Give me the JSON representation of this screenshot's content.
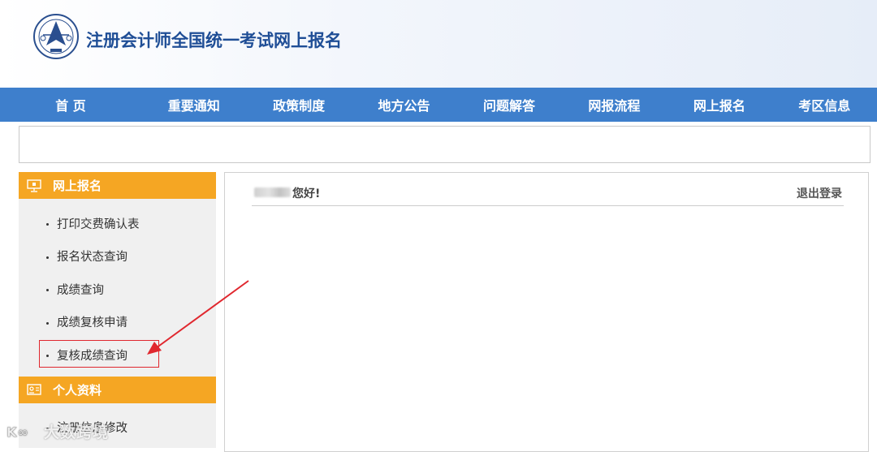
{
  "header": {
    "site_title": "注册会计师全国统一考试网上报名"
  },
  "nav": {
    "items": [
      "首 页",
      "重要通知",
      "政策制度",
      "地方公告",
      "问题解答",
      "网报流程",
      "网上报名",
      "考区信息"
    ]
  },
  "sidebar": {
    "section1_title": "网上报名",
    "section1_items": [
      "打印交费确认表",
      "报名状态查询",
      "成绩查询",
      "成绩复核申请",
      "复核成绩查询"
    ],
    "section2_title": "个人资料",
    "section2_items": [
      "注册信息修改"
    ]
  },
  "main": {
    "greeting": "您好!",
    "logout_label": "退出登录"
  },
  "colors": {
    "nav_bg": "#3e7fcc",
    "section_header": "#f5a623",
    "annotation_red": "#e0272e",
    "title_blue": "#1f4e96"
  },
  "annotation": {
    "highlighted_item": "复核成绩查询"
  },
  "watermark": "大数跨境"
}
